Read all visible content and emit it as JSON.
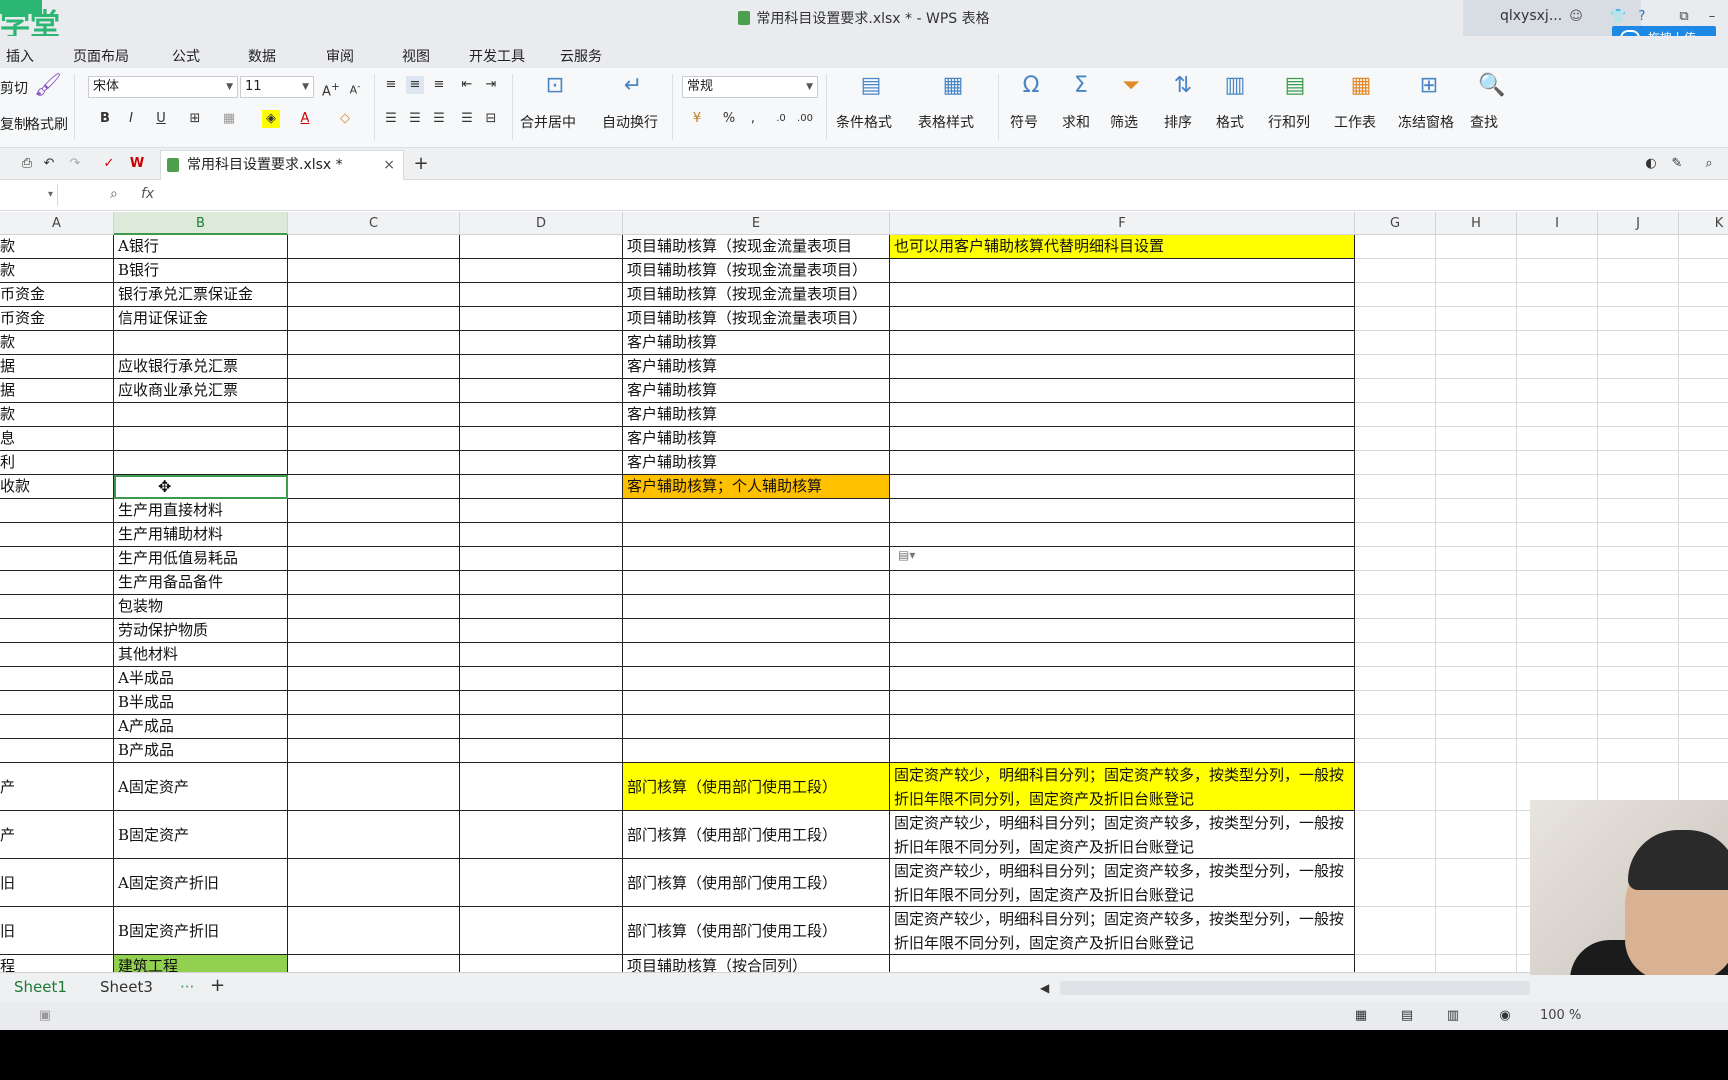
{
  "titlebar": {
    "title": "常用科目设置要求.xlsx * - WPS 表格",
    "user": "qlxysxj...",
    "upload_label": "拖拽上传",
    "logo_text": "学堂"
  },
  "menu": [
    "插入",
    "页面布局",
    "公式",
    "数据",
    "审阅",
    "视图",
    "开发工具",
    "云服务"
  ],
  "ribbon": {
    "cut_label": "剪切",
    "copy_label": "复制",
    "format_painter_label": "格式刷",
    "font_name": "宋体",
    "font_size": "11",
    "number_format": "常规",
    "merge_label": "合并居中",
    "wrap_label": "自动换行",
    "cond_format_label": "条件格式",
    "table_style_label": "表格样式",
    "symbol_label": "符号",
    "sum_label": "求和",
    "filter_label": "筛选",
    "sort_label": "排序",
    "format_label": "格式",
    "rowcol_label": "行和列",
    "sheet_label": "工作表",
    "freeze_label": "冻结窗格",
    "find_label": "查找",
    "percent": "%",
    "comma": ","
  },
  "file_tab": {
    "name": "常用科目设置要求.xlsx *",
    "close": "×",
    "add": "+"
  },
  "formula": {
    "fx": "fx"
  },
  "columns": [
    "A",
    "B",
    "C",
    "D",
    "E",
    "F",
    "G",
    "H",
    "I",
    "J",
    "K"
  ],
  "rows": [
    {
      "a": "款",
      "b": "A银行",
      "e": "项目辅助核算（按现金流量表项目",
      "f": "也可以用客户辅助核算代替明细科目设置",
      "f_style": "yellow"
    },
    {
      "a": "款",
      "b": "B银行",
      "e": "项目辅助核算（按现金流量表项目）",
      "f": ""
    },
    {
      "a": "币资金",
      "b": "银行承兑汇票保证金",
      "e": "项目辅助核算（按现金流量表项目）",
      "f": ""
    },
    {
      "a": "币资金",
      "b": "信用证保证金",
      "e": "项目辅助核算（按现金流量表项目）",
      "f": ""
    },
    {
      "a": "款",
      "b": "",
      "e": "客户辅助核算",
      "f": ""
    },
    {
      "a": "据",
      "b": "应收银行承兑汇票",
      "e": "客户辅助核算",
      "f": ""
    },
    {
      "a": "据",
      "b": "应收商业承兑汇票",
      "e": "客户辅助核算",
      "f": ""
    },
    {
      "a": "款",
      "b": "",
      "e": "客户辅助核算",
      "f": ""
    },
    {
      "a": "息",
      "b": "",
      "e": "客户辅助核算",
      "f": ""
    },
    {
      "a": "利",
      "b": "",
      "e": "客户辅助核算",
      "f": ""
    },
    {
      "a": "收款",
      "b": "",
      "e": "客户辅助核算；个人辅助核算",
      "e_style": "orange",
      "f": "",
      "b_active": true
    },
    {
      "a": "",
      "b": "生产用直接材料",
      "e": "",
      "f": ""
    },
    {
      "a": "",
      "b": "生产用辅助材料",
      "e": "",
      "f": ""
    },
    {
      "a": "",
      "b": "生产用低值易耗品",
      "e": "",
      "f": ""
    },
    {
      "a": "",
      "b": "生产用备品备件",
      "e": "",
      "f": ""
    },
    {
      "a": "",
      "b": "包装物",
      "e": "",
      "f": ""
    },
    {
      "a": "",
      "b": "劳动保护物质",
      "e": "",
      "f": ""
    },
    {
      "a": "",
      "b": "其他材料",
      "e": "",
      "f": ""
    },
    {
      "a": "",
      "b": "A半成品",
      "e": "",
      "f": ""
    },
    {
      "a": "",
      "b": "B半成品",
      "e": "",
      "f": ""
    },
    {
      "a": "",
      "b": "A产成品",
      "e": "",
      "f": ""
    },
    {
      "a": "",
      "b": "B产成品",
      "e": "",
      "f": ""
    },
    {
      "a": "产",
      "b": "A固定资产",
      "e": "部门核算（使用部门使用工段）",
      "e_style": "yellow",
      "f": "固定资产较少，明细科目分列；固定资产较多，按类型分列，一般按折旧年限不同分列，固定资产及折旧台账登记",
      "f_style": "yellow",
      "tall": true
    },
    {
      "a": "产",
      "b": "B固定资产",
      "e": "部门核算（使用部门使用工段）",
      "f": "固定资产较少，明细科目分列；固定资产较多，按类型分列，一般按折旧年限不同分列，固定资产及折旧台账登记",
      "tall": true
    },
    {
      "a": "旧",
      "b": "A固定资产折旧",
      "e": "部门核算（使用部门使用工段）",
      "f": "固定资产较少，明细科目分列；固定资产较多，按类型分列，一般按折旧年限不同分列，固定资产及折旧台账登记",
      "tall": true
    },
    {
      "a": "旧",
      "b": "B固定资产折旧",
      "e": "部门核算（使用部门使用工段）",
      "f": "固定资产较少，明细科目分列；固定资产较多，按类型分列，一般按折旧年限不同分列，固定资产及折旧台账登记",
      "tall": true
    },
    {
      "a": "程",
      "b": "建筑工程",
      "b_style": "green",
      "e": "项目辅助核算（按合同列）",
      "f": ""
    }
  ],
  "sheets": [
    "Sheet1",
    "Sheet3",
    "···",
    "+"
  ],
  "status": {
    "zoom": "100 %"
  },
  "colors": {
    "yellow": "#ffff00",
    "orange": "#ffc000",
    "green": "#92d050",
    "accent": "#1e7b36"
  }
}
